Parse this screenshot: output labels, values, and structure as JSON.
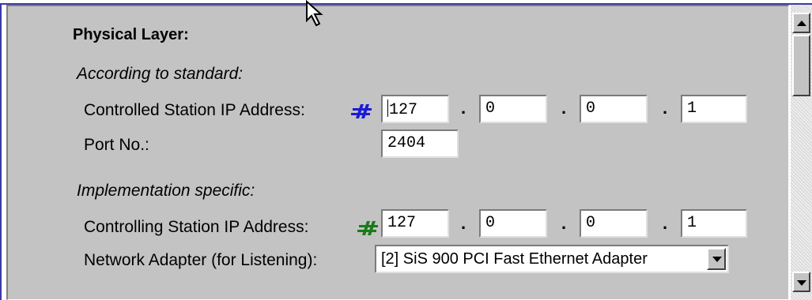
{
  "section": {
    "title": "Physical Layer:",
    "standard_heading": "According to standard:",
    "impl_heading": "Implementation specific:"
  },
  "controlled": {
    "label": "Controlled Station IP Address:",
    "octets": [
      "127",
      "0",
      "0",
      "1"
    ],
    "icon_color": "#1a1ad8"
  },
  "port": {
    "label": "Port No.:",
    "value": "2404"
  },
  "controlling": {
    "label": "Controlling Station IP Address:",
    "octets": [
      "127",
      "0",
      "0",
      "1"
    ],
    "icon_color": "#1a7a1a"
  },
  "adapter": {
    "label": "Network Adapter (for Listening):",
    "selected": "[2] SiS 900 PCI Fast Ethernet Adapter"
  },
  "separators": {
    "dot": "."
  }
}
